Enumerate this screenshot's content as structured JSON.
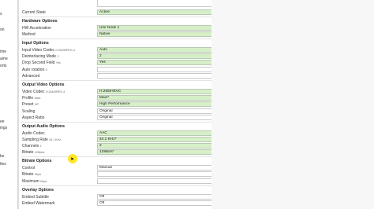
{
  "left_strip": {
    "items": [
      "s",
      "on",
      "ime",
      "ame",
      "orts",
      "",
      "",
      "ee",
      "ings",
      "",
      "bs",
      "ties"
    ]
  },
  "form": {
    "current_state": {
      "label": "Current State",
      "value": "Active"
    },
    "hardware": {
      "title": "Hardware Options",
      "hw_accel": {
        "label": "HW Acceleration",
        "value": "Use Node 1"
      },
      "method": {
        "label": "Method",
        "value": "Native"
      }
    },
    "input": {
      "title": "Input Options",
      "input_codec": {
        "label": "Input Video Codec",
        "hint": "H.264/MPEG-4",
        "value": "Auto"
      },
      "deinterlacing": {
        "label": "Deinterlacing Mode",
        "hint": "2",
        "value": "2"
      },
      "drop_second_field": {
        "label": "Drop Second Field",
        "hint": "Yes",
        "value": "Yes"
      },
      "auto_rotation": {
        "label": "Auto rotation",
        "hint": "0",
        "value": ""
      },
      "advanced": {
        "label": "Advanced",
        "value": ""
      }
    },
    "output_video": {
      "title": "Output Video Options",
      "video_codec": {
        "label": "Video Codec",
        "hint": "H.264/MPEG-4",
        "value": "H.265/HEVC"
      },
      "profile": {
        "label": "Profile",
        "hint": "Main",
        "value": "Main*"
      },
      "preset": {
        "label": "Preset",
        "hint": "HP",
        "value": "High Performance"
      },
      "scaling": {
        "label": "Scaling",
        "value": "Original"
      },
      "aspect_ratio": {
        "label": "Aspect Ratio",
        "value": "Original"
      }
    },
    "output_audio": {
      "title": "Output Audio Options",
      "audio_codec": {
        "label": "Audio Codec",
        "value": "AAC"
      },
      "sampling_rate": {
        "label": "Sampling Rate",
        "hint": "44.1 KHz",
        "value": "44.1 KHz*"
      },
      "channels": {
        "label": "Channels",
        "hint": "2",
        "value": "2"
      },
      "bitrate": {
        "label": "Bitrate",
        "hint": "128kb/s",
        "value": "128kb/s*"
      }
    },
    "bitrate_options": {
      "title": "Bitrate Options",
      "control": {
        "label": "Control",
        "value": "Manual"
      },
      "bitrate": {
        "label": "Bitrate",
        "hint": "Kbps",
        "value": ""
      },
      "maximum": {
        "label": "Maximum",
        "hint": "Kbps",
        "value": ""
      }
    },
    "overlay": {
      "title": "Overlay Options",
      "embed_subtitle": {
        "label": "Embed Subtitle",
        "value": "Off"
      },
      "embed_watermark": {
        "label": "Embed Watermark",
        "value": "Off"
      }
    }
  },
  "icons": {
    "dropdown": "caret-down-icon"
  },
  "colors": {
    "field_green": "#d6efc8",
    "cursor_highlight": "#ffe200"
  }
}
